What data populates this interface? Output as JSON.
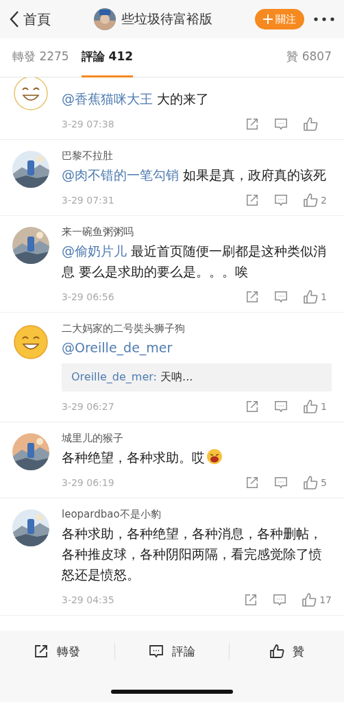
{
  "header": {
    "back_label": "首頁",
    "title": "些垃圾待富裕版",
    "follow_label": "關注"
  },
  "tabs": [
    {
      "label": "轉發 2275",
      "selected": false
    },
    {
      "label": "評論 412",
      "selected": true
    },
    {
      "label": "贊 6807",
      "selected": false
    }
  ],
  "comments": [
    {
      "avatar": {
        "kind": "emoji"
      },
      "mention": "@香蕉猫咪大王",
      "text": "大的来了",
      "time": "3-29 07:38"
    },
    {
      "name": "巴黎不拉肚",
      "mention": "@肉不错的一笔勾销",
      "text": "如果是真，政府真的该死",
      "time": "3-29 07:31",
      "likes": "2"
    },
    {
      "name": "来一碗鱼粥粥吗",
      "mention": "@偷奶片儿",
      "text": "最近首页随便一刷都是这种类似消息 要么是求助的要么是。。。唉",
      "time": "3-29 06:56",
      "likes": "1"
    },
    {
      "avatar": {
        "kind": "emoji"
      },
      "name": "二大妈家的二号奘头狮子狗",
      "mention": "@Oreille_de_mer",
      "quote": {
        "author": "Oreille_de_mer:",
        "text": "天呐..."
      },
      "time": "3-29 06:27",
      "likes": "1"
    },
    {
      "name": "城里儿的猴子",
      "text": "各种绝望，各种求助。哎",
      "emoji": true,
      "time": "3-29 06:19",
      "likes": "5"
    },
    {
      "name": "leopardbao不是小豹",
      "text": "各种求助，各种绝望，各种消息，各种删帖，各种推皮球，各种阴阳两隔，看完感觉除了愤怒还是愤怒。",
      "time": "3-29 04:35",
      "likes": "17"
    }
  ],
  "bottom_bar": [
    {
      "kind": "repost",
      "label": "轉發"
    },
    {
      "kind": "comment",
      "label": "評論"
    },
    {
      "kind": "like",
      "label": "贊"
    }
  ]
}
